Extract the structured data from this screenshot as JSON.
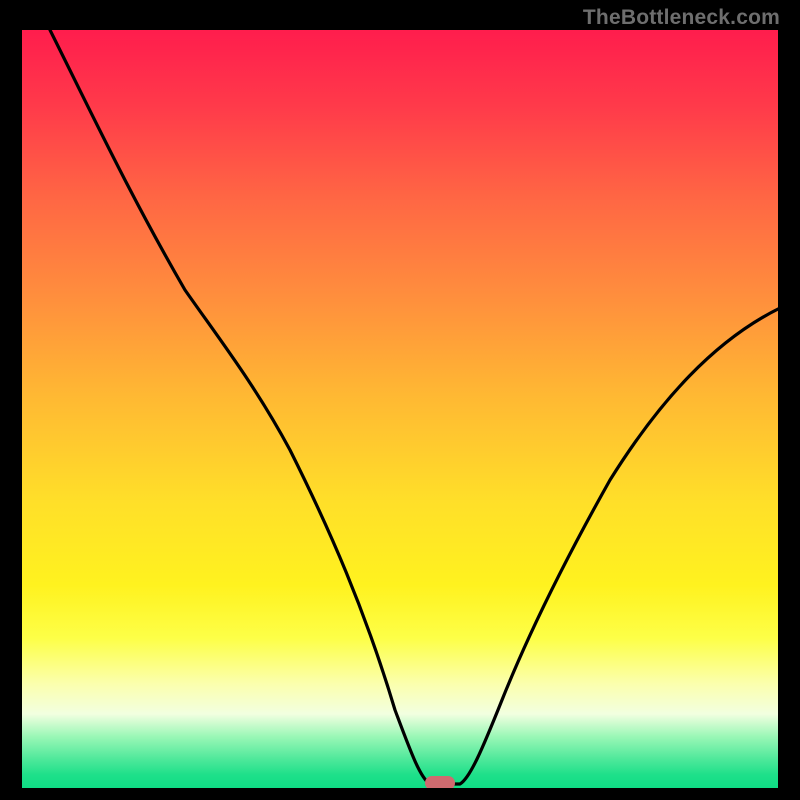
{
  "watermark": {
    "text": "TheBottleneck.com"
  },
  "chart_data": {
    "type": "line",
    "title": "",
    "xlabel": "",
    "ylabel": "",
    "xlim": [
      0,
      100
    ],
    "ylim": [
      0,
      100
    ],
    "grid": false,
    "legend": false,
    "marker": {
      "x": 55,
      "y": 0,
      "color": "#cf6a6f"
    },
    "background_gradient": {
      "top_color": "#ff1d4d",
      "mid_color": "#ffdf29",
      "bottom_color": "#0ddc84"
    },
    "series": [
      {
        "name": "bottleneck-curve",
        "color": "#000000",
        "x": [
          4,
          10,
          16,
          22,
          28,
          33,
          38,
          43,
          47,
          50,
          53,
          55,
          58,
          62,
          66,
          71,
          77,
          84,
          91,
          100
        ],
        "y": [
          100,
          88,
          76,
          65,
          56,
          49,
          41,
          30,
          18,
          8,
          1,
          0,
          1,
          6,
          14,
          24,
          35,
          46,
          55,
          63
        ]
      }
    ]
  }
}
